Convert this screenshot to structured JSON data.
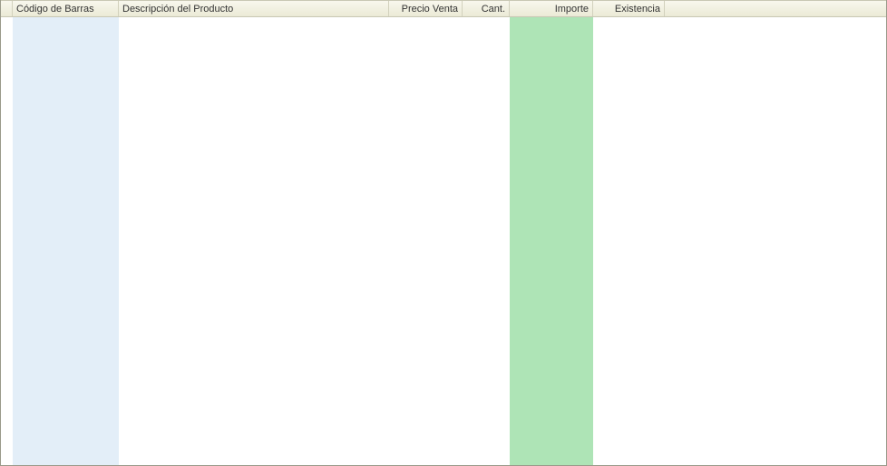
{
  "grid": {
    "columns": {
      "barcode": "Código de Barras",
      "description": "Descripción del Producto",
      "price": "Precio Venta",
      "quantity": "Cant.",
      "amount": "Importe",
      "stock": "Existencia"
    },
    "highlight_colors": {
      "barcode_bg": "#e3eef8",
      "amount_bg": "#aee4b6"
    },
    "rows": []
  }
}
